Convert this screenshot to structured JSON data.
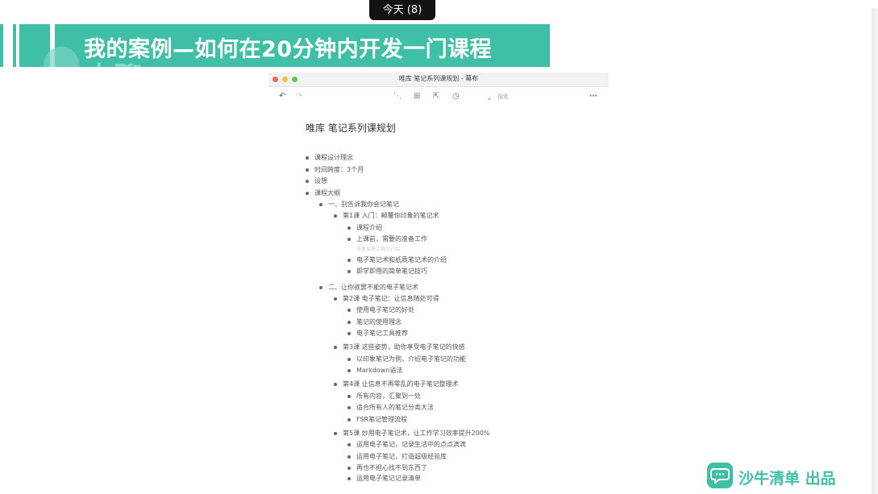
{
  "top_pill": {
    "label": "今天 (8)"
  },
  "banner": {
    "title": "我的案例—如何在20分钟内开发一门课程",
    "ghost_text": "士聊"
  },
  "window": {
    "title": "唯库 笔记系列课规划 - 幕布",
    "toolbar": {
      "search_placeholder": "搜索",
      "undo_icon": "undo-icon",
      "redo_icon": "redo-icon",
      "mindmap_icon": "mindmap-icon",
      "add_icon": "add-node-icon",
      "share_icon": "share-icon",
      "history_icon": "clock-icon",
      "more_icon": "more-icon"
    },
    "document": {
      "title": "唯库 笔记系列课规划",
      "outline": [
        {
          "text": "课程设计理念",
          "level": 0
        },
        {
          "text": "时间跨度：3个月",
          "level": 0
        },
        {
          "text": "设想",
          "level": 0
        },
        {
          "text": "课程大纲",
          "level": 0
        },
        {
          "text": "一、别告诉我你会记笔记",
          "level": 1
        },
        {
          "text": "第1课 入门：颠覆你印象的笔记术",
          "level": 2
        },
        {
          "text": "课程介绍",
          "level": 3
        },
        {
          "text": "上课前，需要的准备工作",
          "level": 3
        },
        {
          "text": "各类准备工具的介绍",
          "level": 3,
          "note": true
        },
        {
          "text": "电子笔记术和纸质笔记术的介绍",
          "level": 3
        },
        {
          "text": "即学即用的简单笔记技巧",
          "level": 3
        },
        {
          "text": "二、让你欲罢不能的电子笔记术",
          "level": 1
        },
        {
          "text": "第2课 电子笔记：让信息随处可得",
          "level": 2
        },
        {
          "text": "使用电子笔记的好处",
          "level": 3
        },
        {
          "text": "笔记的使用理念",
          "level": 3
        },
        {
          "text": "电子笔记工具推荐",
          "level": 3
        },
        {
          "text": "第3课 这些姿势，助你享受电子笔记的快感",
          "level": 2
        },
        {
          "text": "以印象笔记为例，介绍电子笔记的功能",
          "level": 3
        },
        {
          "text": "Markdown语法",
          "level": 3
        },
        {
          "text": "第4课 让信息不再零乱的电子笔记整理术",
          "level": 2
        },
        {
          "text": "所有内容，汇聚到一处",
          "level": 3
        },
        {
          "text": "适合所有人的笔记分类大法",
          "level": 3
        },
        {
          "text": "FSR笔记管理流程",
          "level": 3
        },
        {
          "text": "第5课 妙用电子笔记术，让工作学习效率提升200%",
          "level": 2
        },
        {
          "text": "运用电子笔记，记录生活中的点点滴滴",
          "level": 3
        },
        {
          "text": "运用电子笔记，打造超级经验库",
          "level": 3
        },
        {
          "text": "再也不担心找不到东西了",
          "level": 3
        },
        {
          "text": "运用电子笔记记录清单",
          "level": 3
        }
      ]
    }
  },
  "watermark": {
    "label": "沙牛清单 出品",
    "icon": "chat-bubble-icon"
  },
  "colors": {
    "accent": "#3fc0a6",
    "pill_bg": "#121212"
  }
}
